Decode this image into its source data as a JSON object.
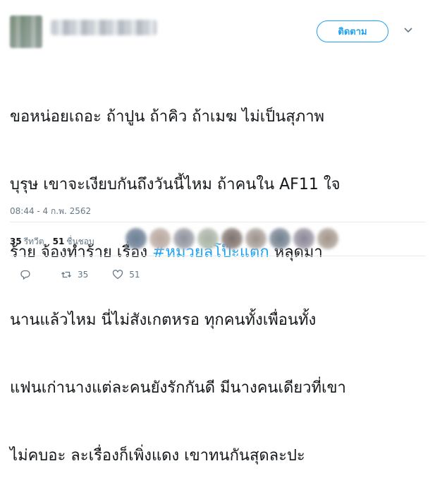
{
  "header": {
    "follow_label": "ติดตาม",
    "caret_icon": "chevron-down-icon"
  },
  "tweet": {
    "line1": "ขอหน่อยเถอะ ถ้าปูน ถ้าคิว ถ้าเมฆ ไม่เป็นสุภาพ",
    "line2": "บุรุษ เขาจะเงียบกันถึงวันนี้ไหม ถ้าคนใน AF11 ใจ",
    "line3_before": "ร้าย จ้องทำร้าย เรื่อง ",
    "hashtag": "#หมวยลี่โป๊ะแตก",
    "line3_after": " หลุดมา",
    "line4": "นานแล้วไหม นี่ไม่สังเกตหรอ ทุกคนทั้งเพื่อนทั้ง",
    "line5": "แฟนเก่านางแต่ละคนยังรักกันดี มีนางคนเดียวที่เขา",
    "line6": "ไม่คบอะ ละเรื่องก็เพิ่งแดง เขาทนกันสุดละปะ",
    "timestamp": "08:44 - 4 ก.พ. 2562"
  },
  "stats": {
    "retweets_count": "35",
    "retweets_label": "รีทวีต",
    "likes_count": "51",
    "likes_label": "ชื่นชอบ"
  },
  "actions": {
    "reply_icon": "reply-icon",
    "retweet_icon": "retweet-icon",
    "retweet_count": "35",
    "like_icon": "heart-icon",
    "like_count": "51"
  },
  "colors": {
    "accent": "#1da1f2",
    "text": "#14171a",
    "muted": "#657786",
    "divider": "#e6ecf0"
  }
}
